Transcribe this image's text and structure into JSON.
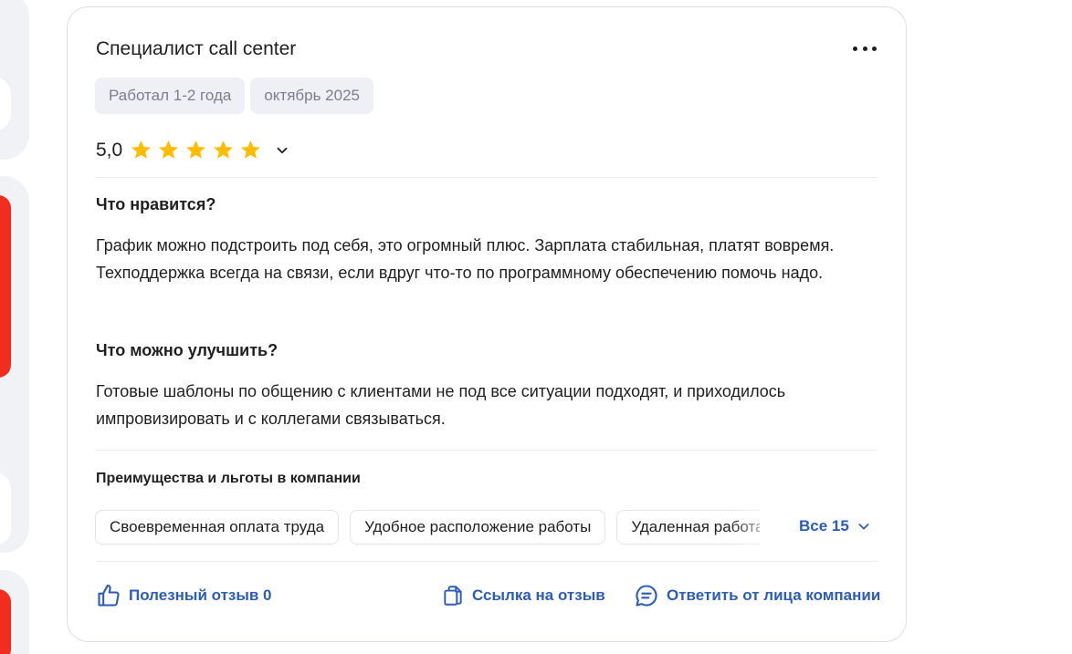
{
  "review": {
    "title": "Специалист call center",
    "chips": [
      "Работал 1-2 года",
      "октябрь 2025"
    ],
    "rating_text": "5,0",
    "rating_value": 5,
    "rating_max": 5,
    "likes_heading": "Что нравится?",
    "likes_text": "График можно подстроить под себя, это огромный плюс. Зарплата стабильная, платят вовремя. Техподдержка всегда на связи, если вдруг что-то по программному обеспечению помочь надо.",
    "improve_heading": "Что можно улучшить?",
    "improve_text": "Готовые шаблоны по общению с клиентами не под все ситуации подходят, и приходилось импровизировать и с коллегами связываться."
  },
  "perks": {
    "title": "Преимущества и льготы в компании",
    "items": [
      "Своевременная оплата труда",
      "Удобное расположение работы",
      "Удаленная работа"
    ],
    "all_label": "Все 15"
  },
  "actions": {
    "helpful_label": "Полезный отзыв 0",
    "link_label": "Ссылка на отзыв",
    "reply_label": "Ответить от лица компании"
  },
  "colors": {
    "accent": "#2b5db8",
    "star": "#ffbd00",
    "side_red": "#f02d1f"
  }
}
